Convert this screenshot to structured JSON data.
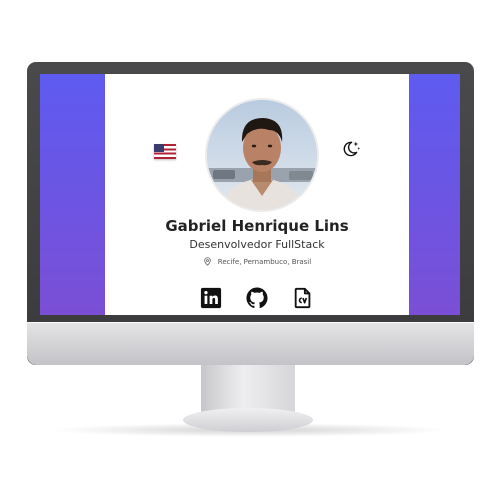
{
  "profile": {
    "name": "Gabriel Henrique Lins",
    "role": "Desenvolvedor FullStack",
    "location": "Recife, Pernambuco, Brasil"
  },
  "controls": {
    "language_flag_icon": "us-flag-icon",
    "theme_toggle_icon": "moon-stars-icon"
  },
  "socials": [
    {
      "icon": "linkedin-icon"
    },
    {
      "icon": "github-icon"
    },
    {
      "icon": "cv-file-icon"
    }
  ],
  "colors": {
    "screen_gradient_top": "#5e5bf0",
    "screen_gradient_bottom": "#7a4fd6",
    "card_background": "#ffffff",
    "bezel": "#3d3d3f",
    "chin": "#d8d8da"
  }
}
